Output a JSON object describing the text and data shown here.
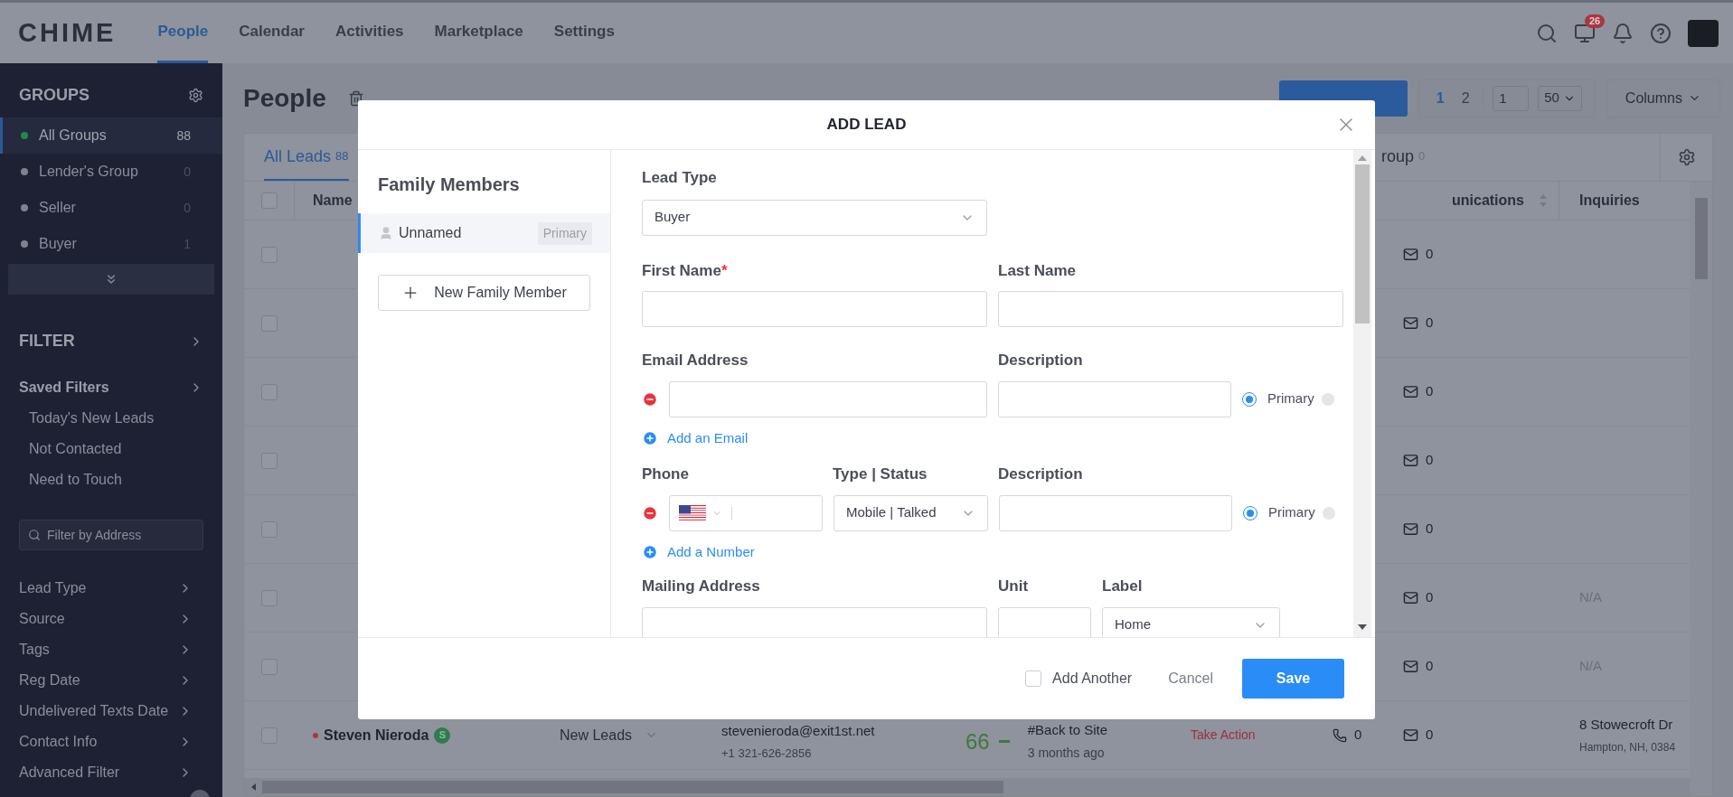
{
  "nav": {
    "logo": "CHIME",
    "items": [
      {
        "label": "People",
        "selected": true
      },
      {
        "label": "Calendar",
        "selected": false
      },
      {
        "label": "Activities",
        "selected": false
      },
      {
        "label": "Marketplace",
        "selected": false
      },
      {
        "label": "Settings",
        "selected": false
      }
    ],
    "badge": "26"
  },
  "sidebar": {
    "groups_title": "GROUPS",
    "groups": [
      {
        "label": "All Groups",
        "count": "88",
        "selected": true,
        "color": "#1f8a4c"
      },
      {
        "label": "Lender's Group",
        "count": "0",
        "selected": false,
        "color": "#80838e"
      },
      {
        "label": "Seller",
        "count": "0",
        "selected": false,
        "color": "#80838e"
      },
      {
        "label": "Buyer",
        "count": "1",
        "selected": false,
        "color": "#80838e"
      }
    ],
    "filter_title": "FILTER",
    "saved_filters_title": "Saved Filters",
    "saved_filters": [
      "Today's New Leads",
      "Not Contacted",
      "Need to Touch"
    ],
    "address_search": {
      "placeholder": "Filter by Address"
    },
    "filters": [
      "Lead Type",
      "Source",
      "Tags",
      "Reg Date",
      "Undelivered Texts Date",
      "Contact Info",
      "Advanced Filter"
    ]
  },
  "page": {
    "title": "People",
    "tabs": [
      {
        "label": "All Leads",
        "count": "88",
        "selected": true
      },
      {
        "label": "roup",
        "count": "0",
        "selected": false
      }
    ],
    "pagination": {
      "pages": [
        {
          "label": "1",
          "selected": true
        },
        {
          "label": "2",
          "selected": false
        }
      ],
      "page_input": "1",
      "page_size": "50"
    },
    "columns_button": "Columns"
  },
  "table": {
    "columns": [
      "Name",
      "unications",
      "Inquiries"
    ],
    "select_all_checked": false,
    "rows": [
      {
        "checked": false,
        "emails": "0"
      },
      {
        "checked": false,
        "emails": "0"
      },
      {
        "checked": false,
        "emails": "0"
      },
      {
        "checked": false,
        "emails": "0"
      },
      {
        "checked": false,
        "emails": "0"
      },
      {
        "checked": false,
        "emails": "0",
        "inquiry": "N/A"
      },
      {
        "checked": false,
        "emails": "0",
        "inquiry": "N/A"
      },
      {
        "checked": false,
        "name": "Steven Nieroda",
        "avatar": "S",
        "stage": "New Leads",
        "email": "stevenieroda@exit1st.net",
        "phone": "+1 321-626-2856",
        "score": "66",
        "activity": "#Back to Site",
        "time": "3 months ago",
        "action": "Take Action",
        "calls": "0",
        "emails": "0",
        "address": "8 Stowecroft Dr",
        "city": "Hampton, NH, 0384"
      }
    ]
  },
  "modal": {
    "title": "ADD LEAD",
    "members_title": "Family Members",
    "members": [
      {
        "name": "Unnamed",
        "badge": "Primary",
        "selected": true
      }
    ],
    "new_member": "New Family Member",
    "lead_type": {
      "label": "Lead Type",
      "value": "Buyer"
    },
    "first_name": {
      "label": "First Name",
      "required_mark": "*"
    },
    "last_name": {
      "label": "Last Name"
    },
    "email": {
      "label": "Email Address",
      "description_label": "Description",
      "primary_label": "Primary",
      "primary": true,
      "add": "Add an Email"
    },
    "phone": {
      "label": "Phone",
      "type_label": "Type | Status",
      "type_value": "Mobile | Talked",
      "description_label": "Description",
      "primary_label": "Primary",
      "primary": true,
      "add": "Add a Number"
    },
    "mailing": {
      "label": "Mailing Address",
      "unit_label": "Unit",
      "label_label": "Label",
      "label_value": "Home"
    },
    "add_another": {
      "label": "Add Another",
      "checked": false
    },
    "cancel": "Cancel",
    "save": "Save"
  }
}
